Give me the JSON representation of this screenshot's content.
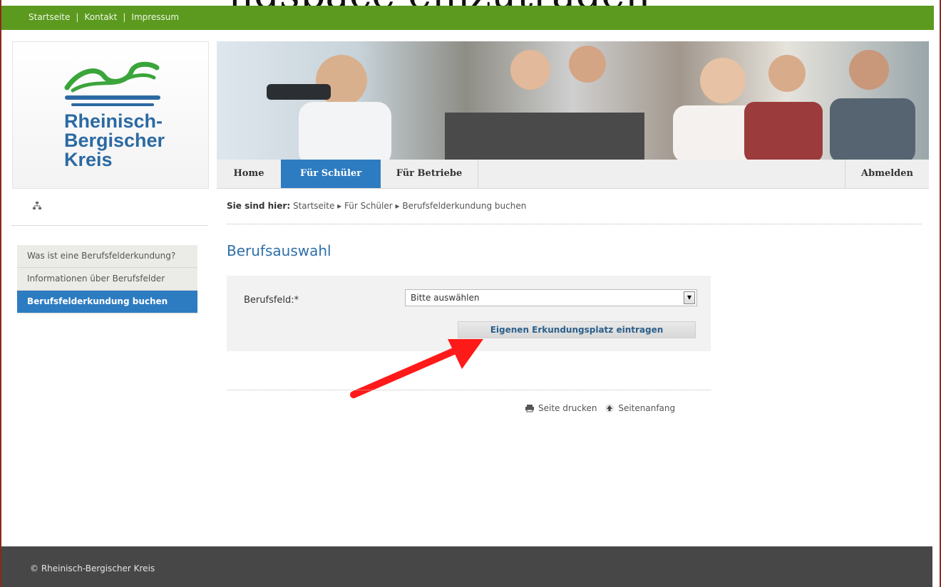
{
  "top_clipped_heading": "ngspace einzutragen",
  "topbar": {
    "links": [
      "Startseite",
      "Kontakt",
      "Impressum"
    ]
  },
  "logo": {
    "lines": [
      "Rheinisch-",
      "Bergischer",
      "Kreis"
    ]
  },
  "nav": {
    "items": [
      "Home",
      "Für Schüler",
      "Für Betriebe"
    ],
    "logout": "Abmelden"
  },
  "breadcrumb": {
    "prefix": "Sie sind hier:",
    "path": "Startseite ▸ Für Schüler ▸ Berufsfelderkundung buchen"
  },
  "sidebar": {
    "items": [
      {
        "label": "Was ist eine Berufsfelderkundung?"
      },
      {
        "label": "Informationen über Berufsfelder"
      },
      {
        "label": "Berufsfelderkundung buchen"
      }
    ]
  },
  "main": {
    "title": "Berufsauswahl",
    "field_label": "Berufsfeld:*",
    "select_value": "Bitte auswählen",
    "entry_button": "Eigenen Erkundungsplatz eintragen"
  },
  "page_actions": {
    "print": "Seite drucken",
    "top": "Seitenanfang"
  },
  "footer": {
    "text": "© Rheinisch-Bergischer Kreis"
  },
  "colors": {
    "green": "#5b9a1f",
    "blue": "#2d7cc1",
    "footer": "#474747",
    "arrow": "#ff1a1a"
  }
}
